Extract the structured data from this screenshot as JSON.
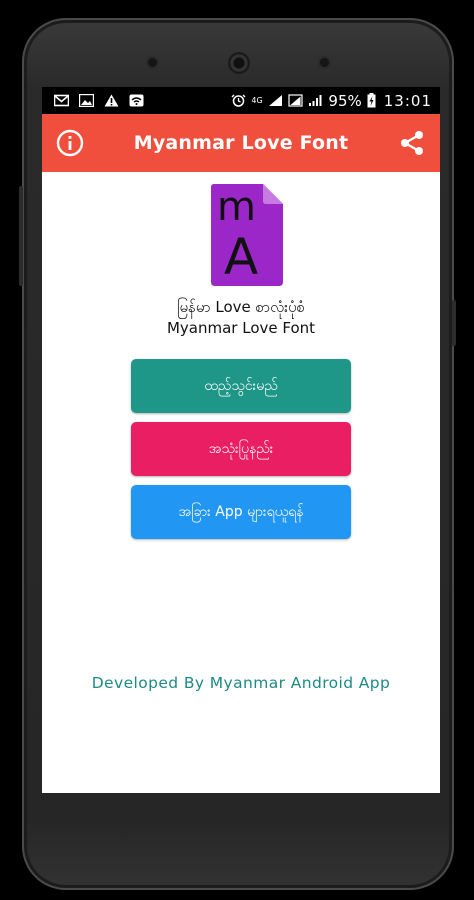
{
  "statusbar": {
    "battery_percent": "95%",
    "time": "13:01",
    "network": "4G"
  },
  "appbar": {
    "title": "Myanmar Love Font",
    "info_icon": "info-icon",
    "share_icon": "share-icon",
    "color": "#f04f3e"
  },
  "logo": {
    "letters_top": "m",
    "letters_bottom": "A",
    "color": "#9b27c9"
  },
  "app_name": {
    "line1": "မြန်မာ Love စာလုံးပုံစံ",
    "line2": "Myanmar Love Font"
  },
  "buttons": [
    {
      "label": "ထည့်သွင်းမည်",
      "color": "#1e9688"
    },
    {
      "label": "အသုံးပြုနည်း",
      "color": "#e91e63"
    },
    {
      "label": "အခြား App များရယူရန်",
      "color": "#2196f3"
    }
  ],
  "footer": {
    "credit": "Developed By Myanmar Android App"
  }
}
